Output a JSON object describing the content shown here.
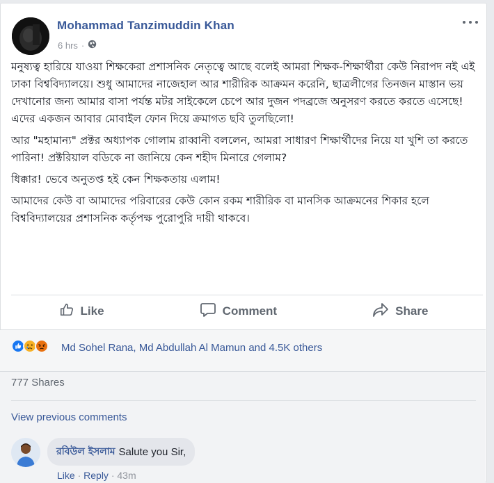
{
  "post": {
    "author": "Mohammad Tanzimuddin Khan",
    "time": "6 hrs",
    "privacy_icon": "globe-icon",
    "paragraphs": [
      "মনুষ্যত্ব হারিয়ে যাওয়া শিক্ষকেরা প্রশাসনিক নেতৃত্বে আছে বলেই আমরা শিক্ষক-শিক্ষার্থীরা কেউ নিরাপদ নই এই ঢাকা বিশ্ববিদ্যালয়ে। শুধু আমাদের নাজেহাল আর শারীরিক আক্রমন করেনি, ছাত্রলীগের তিনজন মাস্তান ভয় দেখানোর জন্য আমার বাসা পর্যন্ত মটর সাইকেলে চেপে আর দুজন পদব্রজে অনুসরণ করতে করতে এসেছে! এদের একজন আবার মোবাইল ফোন দিয়ে ক্রমাগত ছবি তুলছিলো!",
      "আর \"মহামান্য\" প্রক্টর অধ্যাপক গোলাম রাব্বানী বললেন, আমরা সাধারণ শিক্ষার্থীদের নিয়ে যা খুশি তা করতে পারিনা! প্রক্টরিয়াল বডিকে না জানিয়ে কেন শহীদ মিনারে গেলাম?",
      "ধিক্কার! ভেবে অনুতপ্ত হই কেন শিক্ষকতায় এলাম!",
      "আমাদের কেউ বা আমাদের পরিবারের কেউ কোন রকম শারীরিক বা মানসিক আক্রমনের শিকার হলে বিশ্ববিদ্যালয়ের প্রশাসনিক কর্তৃপক্ষ পুরোপুরি দায়ী থাকবে।"
    ]
  },
  "actions": {
    "like": "Like",
    "comment": "Comment",
    "share": "Share"
  },
  "reactions": {
    "types": [
      "like",
      "sad",
      "angry"
    ],
    "colors": {
      "like": "#1877f2",
      "sad": "#f7b125",
      "angry": "#e9710f"
    },
    "summary": "Md Sohel Rana, Md Abdullah Al Mamun and 4.5K others"
  },
  "shares": "777 Shares",
  "view_previous": "View previous comments",
  "comment": {
    "name": "রবিউল ইসলাম",
    "text": "Salute you Sir,",
    "like": "Like",
    "reply": "Reply",
    "time": "43m"
  },
  "colors": {
    "link": "#385898",
    "muted": "#90949c",
    "action": "#606770"
  }
}
